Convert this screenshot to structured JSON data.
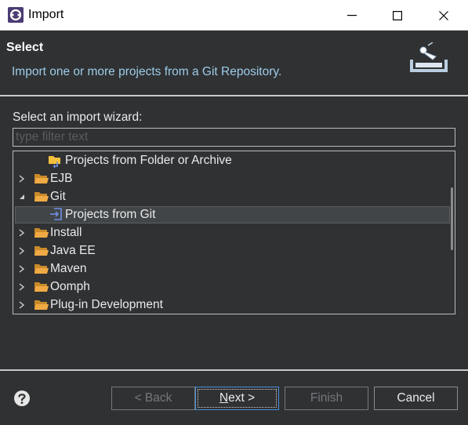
{
  "window": {
    "title": "Import",
    "minimize_icon": "minimize-icon",
    "maximize_icon": "maximize-icon",
    "close_icon": "close-icon"
  },
  "header": {
    "title": "Select",
    "description": "Import one or more projects from a Git Repository."
  },
  "wizard": {
    "label": "Select an import wizard:",
    "filter_placeholder": "type filter text",
    "filter_value": ""
  },
  "tree": {
    "items": [
      {
        "label": "Projects from Folder or Archive",
        "icon": "folder-import-icon",
        "expanded": null,
        "level": 1
      },
      {
        "label": "EJB",
        "icon": "folder-icon",
        "expanded": false,
        "level": 0
      },
      {
        "label": "Git",
        "icon": "folder-icon",
        "expanded": true,
        "level": 0
      },
      {
        "label": "Projects from Git",
        "icon": "git-import-icon",
        "expanded": null,
        "level": 1,
        "selected": true
      },
      {
        "label": "Install",
        "icon": "folder-icon",
        "expanded": false,
        "level": 0
      },
      {
        "label": "Java EE",
        "icon": "folder-icon",
        "expanded": false,
        "level": 0
      },
      {
        "label": "Maven",
        "icon": "folder-icon",
        "expanded": false,
        "level": 0
      },
      {
        "label": "Oomph",
        "icon": "folder-icon",
        "expanded": false,
        "level": 0
      },
      {
        "label": "Plug-in Development",
        "icon": "folder-icon",
        "expanded": false,
        "level": 0
      }
    ]
  },
  "buttons": {
    "back": "< Back",
    "next_mnemonic": "N",
    "next_rest": "ext >",
    "finish": "Finish",
    "cancel": "Cancel"
  },
  "colors": {
    "background": "#2f3133",
    "description_text": "#9ecbe8",
    "folder": "#e8a33d",
    "selection": "#414548",
    "git_icon": "#6f8fe0"
  }
}
